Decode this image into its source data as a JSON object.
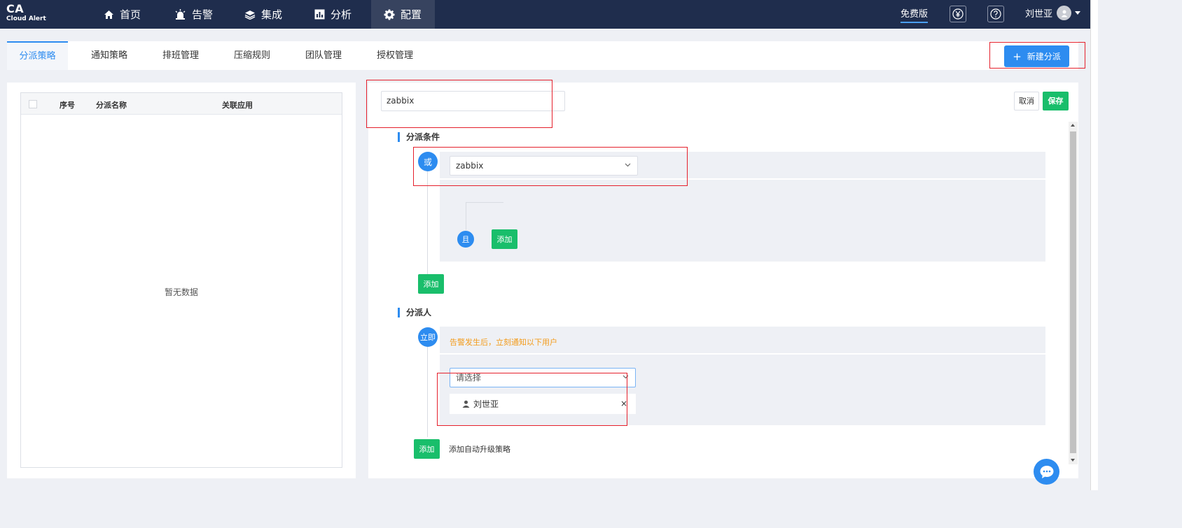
{
  "app": {
    "logo_main": "CA",
    "logo_sub": "Cloud Alert"
  },
  "nav": [
    {
      "label": "首页",
      "icon": "home-icon"
    },
    {
      "label": "告警",
      "icon": "alarm-icon"
    },
    {
      "label": "集成",
      "icon": "layers-icon"
    },
    {
      "label": "分析",
      "icon": "chart-icon"
    },
    {
      "label": "配置",
      "icon": "gear-icon",
      "active": true
    }
  ],
  "header": {
    "plan_label": "免费版",
    "billing_icon": "yen-icon",
    "help_icon": "help-icon",
    "user_name": "刘世亚"
  },
  "tabs": [
    {
      "label": "分派策略",
      "active": true
    },
    {
      "label": "通知策略"
    },
    {
      "label": "排班管理"
    },
    {
      "label": "压缩规则"
    },
    {
      "label": "团队管理"
    },
    {
      "label": "授权管理"
    }
  ],
  "new_button": {
    "plus": "+",
    "label": "新建分派"
  },
  "list": {
    "columns": [
      "序号",
      "分派名称",
      "关联应用"
    ],
    "empty_text": "暂无数据"
  },
  "editor": {
    "name_value": "zabbix",
    "cancel_label": "取消",
    "save_label": "保存",
    "conditions_title": "分派条件",
    "or_label": "或",
    "condition_select_value": "zabbix",
    "and_label": "且",
    "add_inner_label": "添加",
    "add_outer_label": "添加",
    "assignee_title": "分派人",
    "immediate_label": "立即",
    "notify_hint": "告警发生后，立刻通知以下用户",
    "user_select_placeholder": "请选择",
    "selected_user": "刘世亚",
    "remove_glyph": "×",
    "add_escalation_label": "添加",
    "add_escalation_text": "添加自动升级策略"
  },
  "colors": {
    "topbar": "#1f2d4d",
    "primary": "#2d8cf0",
    "success": "#19be6b",
    "warning": "#f39b1a",
    "annotation": "#e5202c"
  }
}
